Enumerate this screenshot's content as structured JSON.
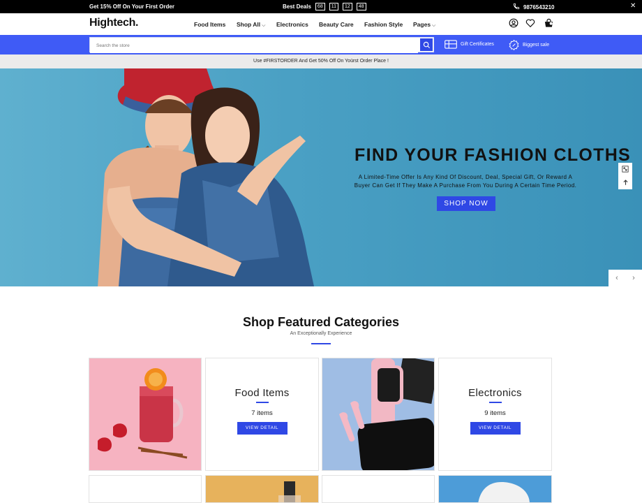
{
  "topbar": {
    "promo": "Get 15% Off On Your First Order",
    "deals_label": "Best Deals",
    "countdown": [
      "68",
      "11",
      "12",
      "48"
    ],
    "phone": "9876543210"
  },
  "header": {
    "logo": "Hightech.",
    "nav": [
      "Food Items",
      "Shop All",
      "Electronics",
      "Beauty Care",
      "Fashion Style",
      "Pages"
    ]
  },
  "search": {
    "placeholder": "Search the store",
    "links": [
      "Gift Certificates",
      "Biggest sale"
    ]
  },
  "announcement": "Use #FIRSTORDER And Get 50% Off On Yoürst Order Place !",
  "hero": {
    "title": "FIND YOUR FASHION CLOTHS",
    "text": "A Limited-Time Offer Is Any Kind Of Discount, Deal, Special Gift, Or Reward A Buyer Can Get If They Make A Purchase From You During A Certain Time Period.",
    "cta": "SHOP NOW"
  },
  "featured": {
    "title": "Shop Featured Categories",
    "subtitle": "An Exceptionally Experience",
    "categories": [
      {
        "name": "Food Items",
        "count": "7 items",
        "button": "VIEW DETAIL"
      },
      {
        "name": "Electronics",
        "count": "9 items",
        "button": "VIEW DETAIL"
      }
    ]
  },
  "colors": {
    "accent": "#3f5bf6",
    "button": "#2f48e5",
    "topbar": "#000000",
    "hero_bg": "#4aa0c4"
  }
}
